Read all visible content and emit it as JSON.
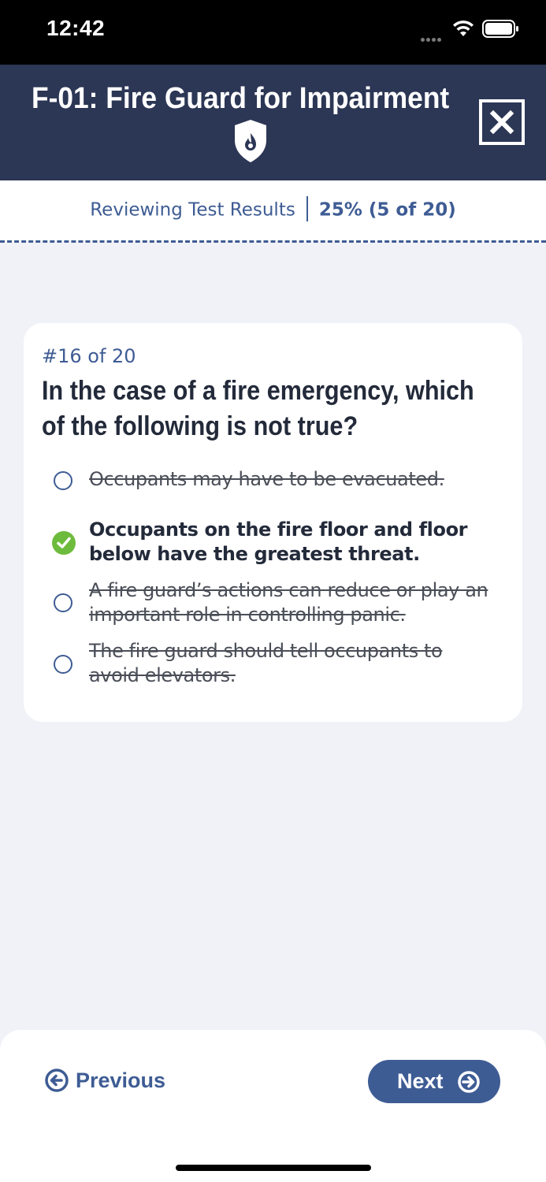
{
  "status_bar": {
    "time": "12:42"
  },
  "header": {
    "title": "F-01: Fire Guard for Impairment",
    "logo_icon": "flame-shield-icon",
    "close_icon": "close-icon"
  },
  "progress": {
    "label": "Reviewing Test Results",
    "score": "25% (5 of 20)"
  },
  "question": {
    "number": "#16 of 20",
    "text": "In the case of a fire emergency, which of the following is not true?",
    "options": [
      {
        "text": "Occupants may have to be evacuated.",
        "state": "struck"
      },
      {
        "text": "Occupants on the fire floor and floor below have the greatest threat.",
        "state": "correct"
      },
      {
        "text": "A fire guard’s actions can reduce or play an important role in controlling panic.",
        "state": "struck"
      },
      {
        "text": "The fire guard should tell occupants to avoid elevators.",
        "state": "struck"
      }
    ]
  },
  "footer": {
    "previous_label": "Previous",
    "next_label": "Next"
  },
  "colors": {
    "header_bg": "#2c3655",
    "accent": "#3e5c94",
    "correct": "#6dbb3c",
    "page_bg": "#f1f2f7"
  }
}
